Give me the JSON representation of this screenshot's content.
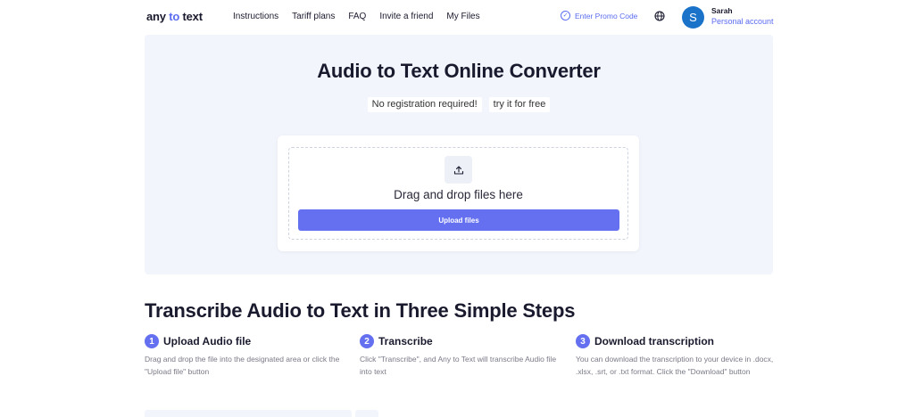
{
  "header": {
    "logo": {
      "part1": "any ",
      "accent": "to",
      "part2": " text"
    },
    "nav": [
      "Instructions",
      "Tariff plans",
      "FAQ",
      "Invite a friend",
      "My Files"
    ],
    "promo": "Enter Promo Code",
    "user": {
      "avatar_letter": "S",
      "name": "Sarah",
      "account": "Personal account"
    }
  },
  "hero": {
    "title": "Audio to Text Online Converter",
    "tags": [
      "No registration required!",
      "try it for free"
    ],
    "drop_text": "Drag and drop files here",
    "upload_button": "Upload files"
  },
  "steps": {
    "title": "Transcribe Audio to Text in Three Simple Steps",
    "items": [
      {
        "num": "1",
        "title": "Upload Audio file",
        "desc": "Drag and drop the file into the designated area or click the \"Upload file\" button"
      },
      {
        "num": "2",
        "title": "Transcribe",
        "desc": "Click \"Transcribe\", and Any to Text will transcribe Audio file into text"
      },
      {
        "num": "3",
        "title": "Download transcription",
        "desc": "You can download the transcription to your device in .docx, .xlsx, .srt, or .txt format. Click the \"Download\" button"
      }
    ]
  },
  "colors": {
    "accent": "#5b6cf0",
    "button": "#6470f0",
    "hero_bg": "#f3f5fd",
    "avatar": "#1a73c9"
  },
  "icons": {
    "promo": "check-circle-icon",
    "language": "globe-icon",
    "upload": "upload-icon"
  }
}
